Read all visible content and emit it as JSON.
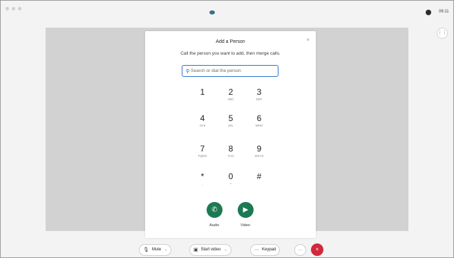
{
  "top_bar": {
    "clock": "06:11",
    "side_button_icon": "grid-icon"
  },
  "dialog": {
    "title": "Add a Person",
    "close_icon": "×",
    "subtitle": "Call the person you want to add, then merge calls.",
    "search": {
      "placeholder": "Search or dial the person",
      "value": ""
    }
  },
  "keypad": {
    "keys": [
      {
        "digit": "1",
        "letters": ""
      },
      {
        "digit": "2",
        "letters": "ABC"
      },
      {
        "digit": "3",
        "letters": "DEF"
      },
      {
        "digit": "4",
        "letters": "GHI"
      },
      {
        "digit": "5",
        "letters": "JKL"
      },
      {
        "digit": "6",
        "letters": "MNO"
      },
      {
        "digit": "7",
        "letters": "PQRS"
      },
      {
        "digit": "8",
        "letters": "TUV"
      },
      {
        "digit": "9",
        "letters": "WXYZ"
      },
      {
        "digit": "*",
        "letters": ","
      },
      {
        "digit": "0",
        "letters": "+"
      },
      {
        "digit": "#",
        "letters": ""
      }
    ]
  },
  "call_actions": {
    "audio": {
      "label": "Audio",
      "icon": "phone-icon"
    },
    "video": {
      "label": "Video",
      "icon": "video-icon"
    }
  },
  "toolbar": {
    "mute_label": "Mute",
    "start_video_label": "Start video",
    "keypad_label": "Keypad",
    "more_label": "…",
    "end_label": "×"
  },
  "colors": {
    "accent_green": "#1c7a52",
    "end_call_red": "#d2283c",
    "focus_blue": "#2a73cc"
  }
}
